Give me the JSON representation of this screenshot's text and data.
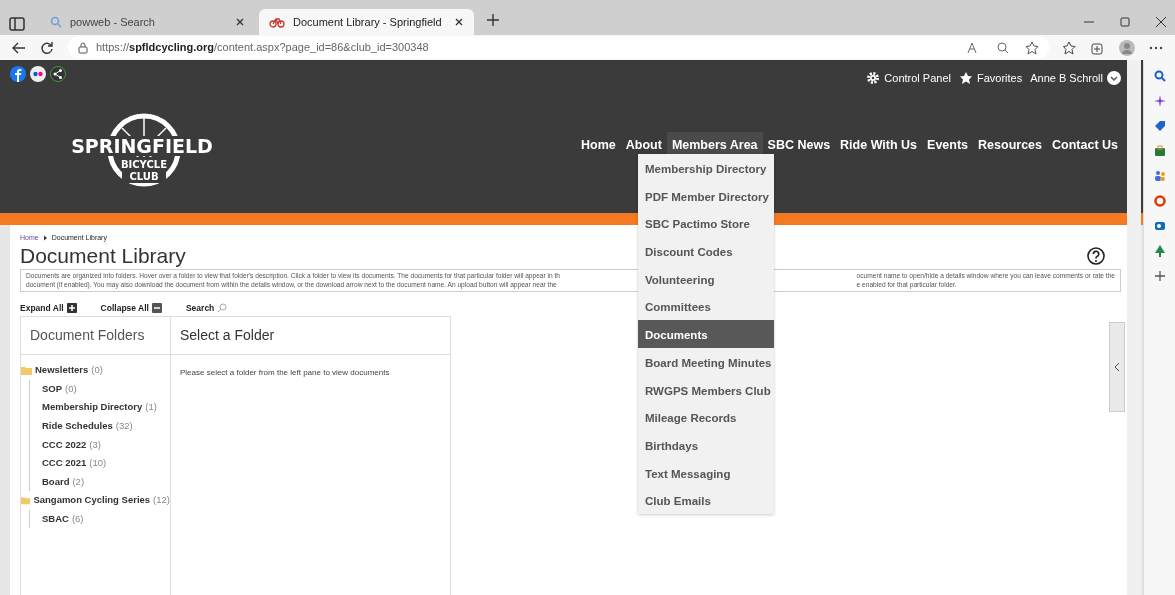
{
  "browser": {
    "tabs": [
      {
        "title": "powweb - Search",
        "selected": false
      },
      {
        "title": "Document Library - Springfield",
        "selected": true
      }
    ],
    "url": "https://**spfldcycling.org**/content.aspx?page_id=86&club_id=300348"
  },
  "header": {
    "utility_links": [
      {
        "kind": "gear",
        "label": "Control Panel"
      },
      {
        "kind": "star",
        "label": "Favorites"
      },
      {
        "kind": "user",
        "label": "Anne B Schroll"
      }
    ],
    "logo": {
      "name": "SPRINGFIELD",
      "line_2": "BICYCLE",
      "line_3": "CLUB"
    },
    "nav": [
      {
        "label": "Home",
        "expanded": false
      },
      {
        "label": "About",
        "expanded": false
      },
      {
        "label": "Members Area",
        "expanded": true
      },
      {
        "label": "SBC News",
        "expanded": false
      },
      {
        "label": "Ride With Us",
        "expanded": false
      },
      {
        "label": "Events",
        "expanded": false
      },
      {
        "label": "Resources",
        "expanded": false
      },
      {
        "label": "Contact Us",
        "expanded": false
      }
    ],
    "dropdown": [
      {
        "label": "Membership Directory",
        "selected": false
      },
      {
        "label": "PDF Member Directory",
        "selected": false
      },
      {
        "label": "SBC Pactimo Store",
        "selected": false
      },
      {
        "label": "Discount Codes",
        "selected": false
      },
      {
        "label": "Volunteering",
        "selected": false
      },
      {
        "label": "Committees",
        "selected": false
      },
      {
        "label": "Documents",
        "selected": true
      },
      {
        "label": "Board Meeting Minutes",
        "selected": false
      },
      {
        "label": "RWGPS Members Club",
        "selected": false
      },
      {
        "label": "Mileage Records",
        "selected": false
      },
      {
        "label": "Birthdays",
        "selected": false
      },
      {
        "label": "Text Messaging",
        "selected": false
      },
      {
        "label": "Club Emails",
        "selected": false
      }
    ]
  },
  "breadcrumb": [
    "Home",
    "Document Library"
  ],
  "title": "Document Library",
  "description": {
    "left_lines": [
      "Documents are organized into folders. Hover over a folder to view that folder's description. Click a folder to view its documents. The documents for that particular folder will appear in th",
      "document (if enabled). You may also download the document from within the details window, or the download arrow next to the document name. An upload button will appear near the"
    ],
    "right_lines": [
      "ocument name to open/hide a details window where you can leave comments or rate the",
      "e enabled for that particular folder."
    ]
  },
  "toolbar": [
    {
      "kind": "expand",
      "label": "Expand All"
    },
    {
      "kind": "collapse",
      "label": "Collapse All"
    },
    {
      "kind": "search",
      "label": "Search"
    }
  ],
  "folders_panel": {
    "title": "Document Folders",
    "tree": [
      {
        "name": "Newsletters",
        "count": "(0)",
        "children": [
          {
            "name": "SOP",
            "count": "(0)"
          },
          {
            "name": "Membership Directory",
            "count": "(1)"
          },
          {
            "name": "Ride Schedules",
            "count": "(32)"
          },
          {
            "name": "CCC 2022",
            "count": "(3)"
          },
          {
            "name": "CCC 2021",
            "count": "(10)"
          },
          {
            "name": "Board",
            "count": "(2)"
          }
        ]
      },
      {
        "name": "Sangamon Cycling Series",
        "count": "(12)",
        "children": [
          {
            "name": "SBAC",
            "count": "(6)"
          }
        ]
      }
    ]
  },
  "documents_panel": {
    "title": "Select a Folder",
    "message": "Please select a folder from the left pane to view documents"
  }
}
